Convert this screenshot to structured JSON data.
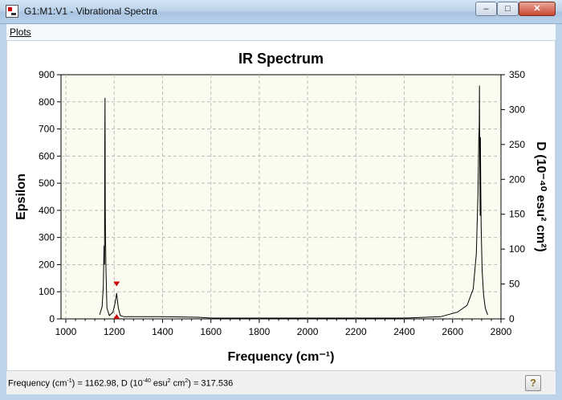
{
  "window": {
    "title": "G1:M1:V1 - Vibrational Spectra",
    "minimize_glyph": "–",
    "maximize_glyph": "□",
    "close_glyph": "✕"
  },
  "menu": {
    "plots": "Plots"
  },
  "status": {
    "p1": "Frequency (cm",
    "e1": "-1",
    "p2": ") = 1162.98, D (10",
    "e2": "-40",
    "p3": " esu",
    "e3": "2",
    "p4": " cm",
    "e4": "2",
    "p5": ") = 317.536",
    "help_glyph": "?"
  },
  "colors": {
    "plot_background": "#fbfbef",
    "line": "#000000",
    "marker": "#cc0000",
    "grid": "#bdbdbd"
  },
  "chart_data": {
    "type": "line",
    "title": "IR Spectrum",
    "xlabel": "Frequency (cm⁻¹)",
    "ylabel_left": "Epsilon",
    "ylabel_right": "D (10⁻⁴⁰ esu² cm²)",
    "xlim": [
      980,
      2800
    ],
    "ylim_left": [
      0,
      900
    ],
    "ylim_right": [
      0,
      350
    ],
    "x_ticks": [
      1000,
      1200,
      1400,
      1600,
      1800,
      2000,
      2200,
      2400,
      2600,
      2800
    ],
    "y_ticks_left": [
      0,
      100,
      200,
      300,
      400,
      500,
      600,
      700,
      800,
      900
    ],
    "y_ticks_right": [
      0,
      50,
      100,
      150,
      200,
      250,
      300,
      350
    ],
    "grid": true,
    "series": [
      {
        "x": [
          1140,
          1150,
          1155,
          1158,
          1160,
          1161,
          1162,
          1163,
          1164,
          1166,
          1170,
          1180,
          1195,
          1203,
          1207,
          1210,
          1213,
          1217,
          1225,
          1240,
          1400,
          1550,
          1600,
          1800,
          2000,
          2200,
          2400,
          2550,
          2620,
          2660,
          2685,
          2698,
          2705,
          2708,
          2710,
          2711,
          2712,
          2713,
          2714,
          2715,
          2716,
          2718,
          2722,
          2728,
          2735,
          2745
        ],
        "y": [
          15,
          45,
          120,
          270,
          200,
          640,
          815,
          420,
          300,
          180,
          40,
          12,
          25,
          55,
          75,
          95,
          70,
          40,
          12,
          8,
          8,
          6,
          3,
          3,
          3,
          3,
          3,
          8,
          25,
          50,
          110,
          240,
          470,
          660,
          710,
          860,
          600,
          490,
          380,
          670,
          520,
          340,
          180,
          90,
          40,
          15
        ]
      }
    ],
    "selected_peak": {
      "x": 1210,
      "y": 120
    }
  }
}
